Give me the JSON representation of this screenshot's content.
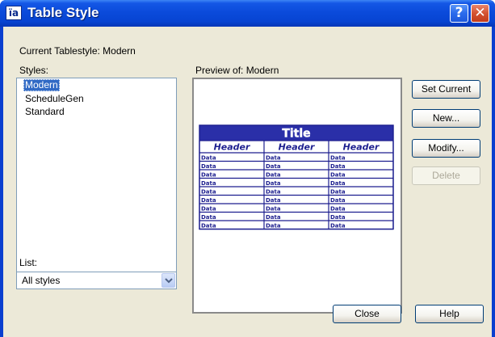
{
  "window": {
    "title": "Table Style",
    "icon_glyph": "ïa",
    "help_glyph": "?",
    "close_glyph": "✕"
  },
  "current_tablestyle": "Current Tablestyle: Modern",
  "styles": {
    "label": "Styles:",
    "items": [
      {
        "label": "Modern",
        "selected": true
      },
      {
        "label": "ScheduleGen",
        "selected": false
      },
      {
        "label": "Standard",
        "selected": false
      }
    ]
  },
  "list_filter": {
    "label": "List:",
    "value": "All styles"
  },
  "preview": {
    "label": "Preview of: Modern",
    "table": {
      "title": "Title",
      "headers": [
        "Header",
        "Header",
        "Header"
      ],
      "rows": [
        [
          "Data",
          "Data",
          "Data"
        ],
        [
          "Data",
          "Data",
          "Data"
        ],
        [
          "Data",
          "Data",
          "Data"
        ],
        [
          "Data",
          "Data",
          "Data"
        ],
        [
          "Data",
          "Data",
          "Data"
        ],
        [
          "Data",
          "Data",
          "Data"
        ],
        [
          "Data",
          "Data",
          "Data"
        ],
        [
          "Data",
          "Data",
          "Data"
        ],
        [
          "Data",
          "Data",
          "Data"
        ]
      ],
      "colors": {
        "title_bg": "#2a2fa8",
        "lines": "#1d1f8f",
        "text": "#1d1f8f"
      }
    }
  },
  "buttons": {
    "set_current": "Set Current",
    "new": "New...",
    "modify": "Modify...",
    "delete": "Delete",
    "close": "Close",
    "help": "Help"
  },
  "colors": {
    "titlebar": "#0b4bdb",
    "dialog_bg": "#ece9d8",
    "selection": "#316ac5"
  }
}
